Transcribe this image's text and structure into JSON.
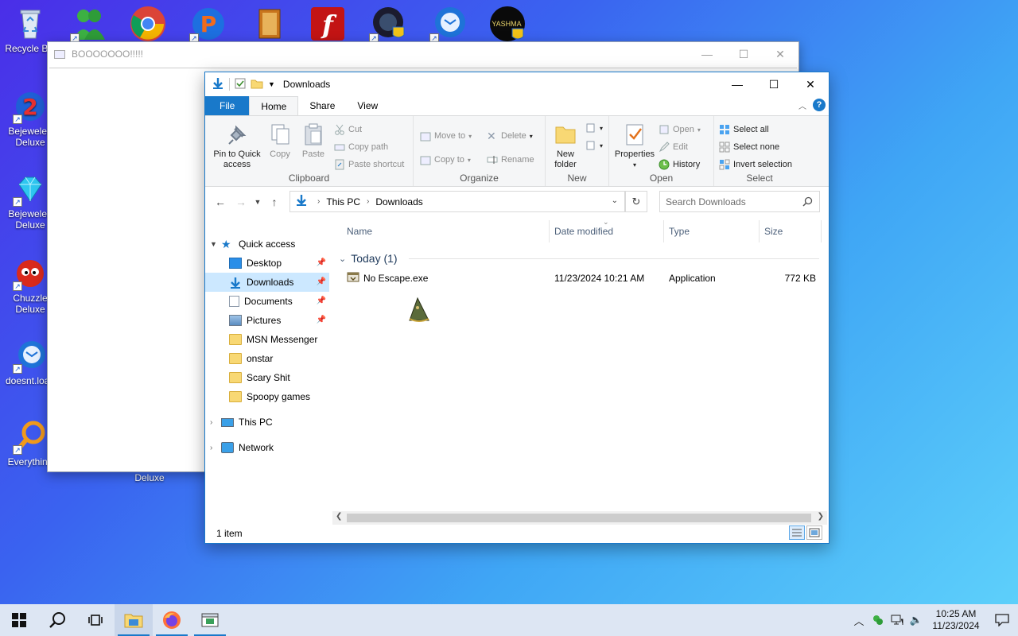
{
  "desktop": {
    "icons": [
      {
        "label": "Recycle Bin"
      },
      {
        "label": "Bejeweled Deluxe"
      },
      {
        "label": "Bejeweled Deluxe"
      },
      {
        "label": "Chuzzle Deluxe"
      },
      {
        "label": "doesnt.load"
      },
      {
        "label": "Everything"
      },
      {
        "label": "Deluxe"
      }
    ],
    "top_icon_text": "YASHMA"
  },
  "bg_window": {
    "title": "BOOOOOOO!!!!!"
  },
  "explorer": {
    "title": "Downloads",
    "tabs": {
      "file": "File",
      "home": "Home",
      "share": "Share",
      "view": "View"
    },
    "ribbon": {
      "clipboard": {
        "group": "Clipboard",
        "pin": "Pin to Quick access",
        "copy": "Copy",
        "paste": "Paste",
        "cut": "Cut",
        "copy_path": "Copy path",
        "paste_shortcut": "Paste shortcut"
      },
      "organize": {
        "group": "Organize",
        "move_to": "Move to",
        "copy_to": "Copy to",
        "delete": "Delete",
        "rename": "Rename"
      },
      "new": {
        "group": "New",
        "new_folder": "New folder"
      },
      "open": {
        "group": "Open",
        "properties": "Properties",
        "open": "Open",
        "edit": "Edit",
        "history": "History"
      },
      "select": {
        "group": "Select",
        "select_all": "Select all",
        "select_none": "Select none",
        "invert": "Invert selection"
      }
    },
    "address": {
      "crumbs": [
        "This PC",
        "Downloads"
      ],
      "search_placeholder": "Search Downloads"
    },
    "nav": {
      "quick_access": "Quick access",
      "items": [
        {
          "label": "Desktop",
          "pinned": true
        },
        {
          "label": "Downloads",
          "pinned": true,
          "selected": true
        },
        {
          "label": "Documents",
          "pinned": true
        },
        {
          "label": "Pictures",
          "pinned": true
        },
        {
          "label": "MSN Messenger"
        },
        {
          "label": "onstar"
        },
        {
          "label": "Scary Shit"
        },
        {
          "label": "Spoopy games"
        }
      ],
      "this_pc": "This PC",
      "network": "Network"
    },
    "columns": {
      "name": "Name",
      "date": "Date modified",
      "type": "Type",
      "size": "Size"
    },
    "group_header": "Today (1)",
    "files": [
      {
        "name": "No Escape.exe",
        "date": "11/23/2024 10:21 AM",
        "type": "Application",
        "size": "772 KB"
      }
    ],
    "status": "1 item"
  },
  "taskbar": {
    "time": "10:25 AM",
    "date": "11/23/2024"
  },
  "colors": {
    "accent": "#1979ca",
    "selection": "#cce8ff",
    "folder": "#f8d874"
  }
}
